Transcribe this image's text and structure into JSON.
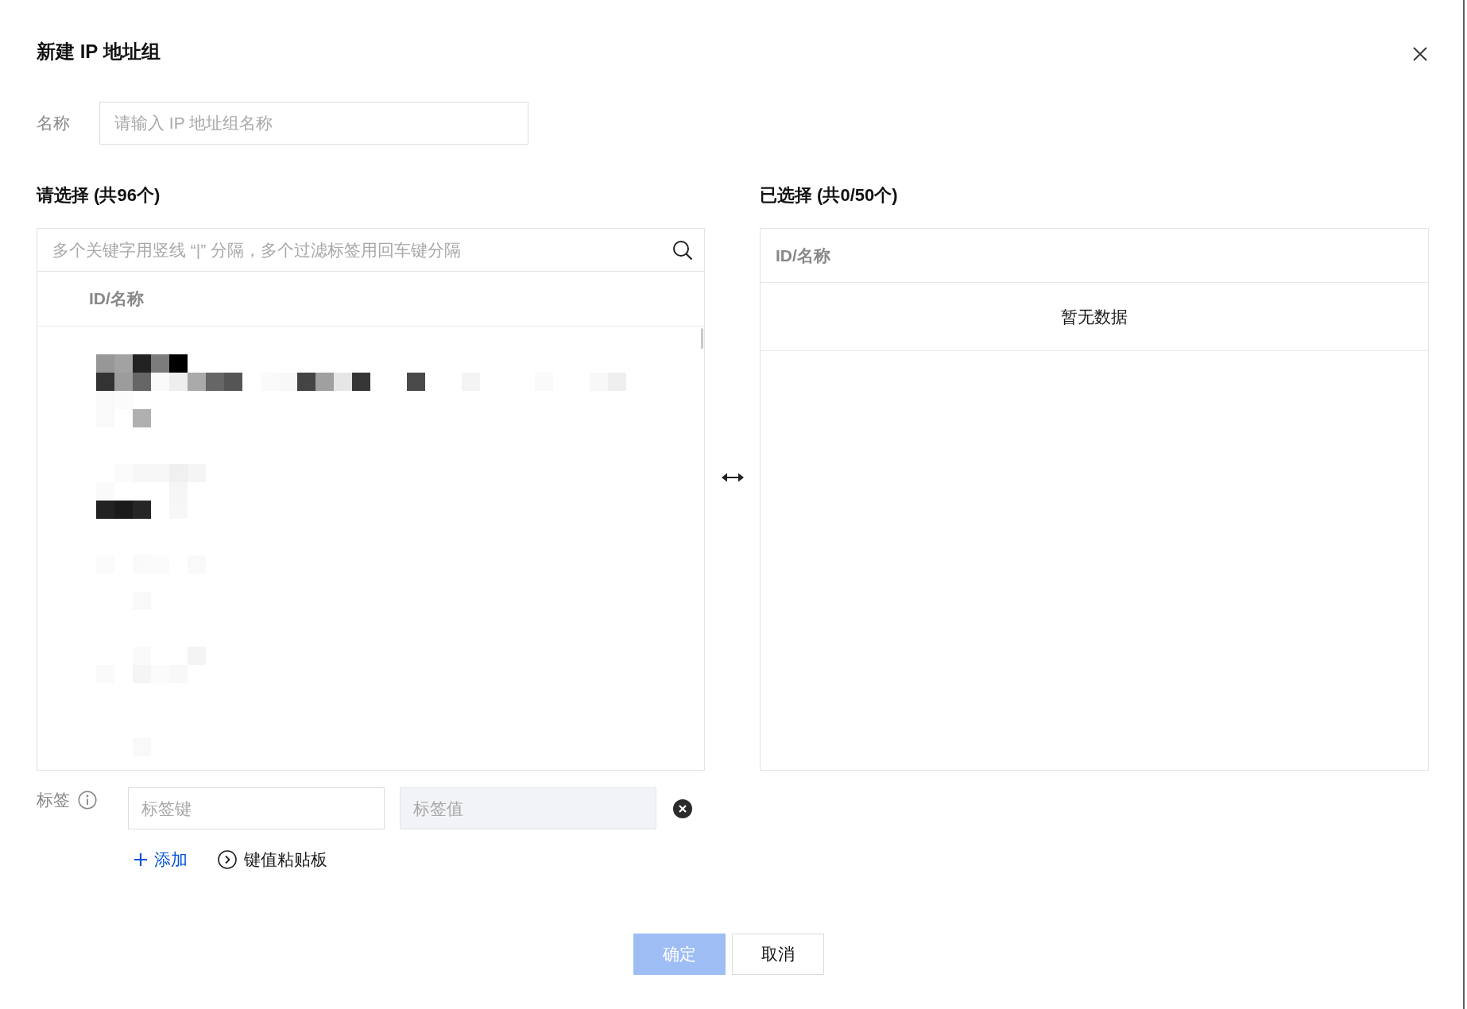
{
  "dialog": {
    "title": "新建 IP 地址组"
  },
  "name_field": {
    "label": "名称",
    "placeholder": "请输入 IP 地址组名称"
  },
  "source_panel": {
    "title": "请选择 (共96个)",
    "search": {
      "placeholder": "多个关键字用竖线 “|” 分隔，多个过滤标签用回车键分隔"
    },
    "columns": [
      "ID/名称"
    ]
  },
  "target_panel": {
    "title": "已选择 (共0/50个)",
    "columns": [
      "ID/名称"
    ],
    "empty_text": "暂无数据"
  },
  "tags": {
    "label": "标签",
    "rows": [
      {
        "key_placeholder": "标签键",
        "value_placeholder": "标签值",
        "value_disabled": true
      }
    ],
    "actions": [
      {
        "kind": "add",
        "label": "添加"
      },
      {
        "kind": "paste",
        "label": "键值粘贴板"
      }
    ]
  },
  "footer": {
    "buttons": [
      {
        "kind": "primary",
        "label": "确定",
        "disabled": true
      },
      {
        "kind": "default",
        "label": "取消",
        "disabled": false
      }
    ]
  }
}
